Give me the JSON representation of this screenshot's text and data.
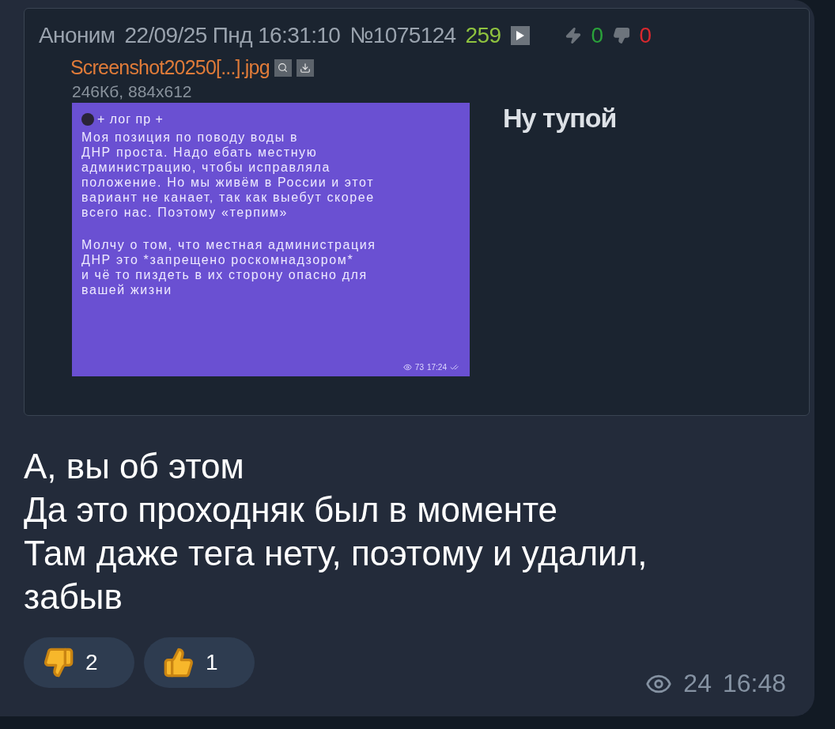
{
  "post": {
    "author": "Аноним",
    "date": "22/09/25 Пнд 16:31:10",
    "number": "№1075124",
    "replies": "259",
    "likes": "0",
    "dislikes": "0",
    "file": {
      "name": "Screenshot20250[...].jpg",
      "info": "246Кб, 884x612"
    },
    "image": {
      "channel": "+ лог пр +",
      "paragraphs": [
        [
          "Моя позиция по поводу воды в",
          "ДНР проста. Надо ебать местную",
          "администрацию, чтобы исправляла",
          "положение. Но мы живём в России и этот",
          "вариант не канает, так как выебут скорее",
          "всего нас. Поэтому «терпим»"
        ],
        [
          "Молчу о том, что местная администрация",
          "ДНР это *запрещено роскомнадзором*",
          "и чё то пиздеть в их сторону опасно для",
          "вашей жизни"
        ]
      ],
      "views": "73",
      "time": "17:24"
    },
    "text": "Ну тупой"
  },
  "message": {
    "lines": [
      "А, вы об этом",
      "Да это проходняк был в моменте",
      "Там даже тега нету, поэтому и удалил, забыв"
    ],
    "reactions": [
      {
        "kind": "thumbs-down",
        "count": "2"
      },
      {
        "kind": "thumbs-up",
        "count": "1"
      }
    ],
    "views": "24",
    "time": "16:48"
  }
}
